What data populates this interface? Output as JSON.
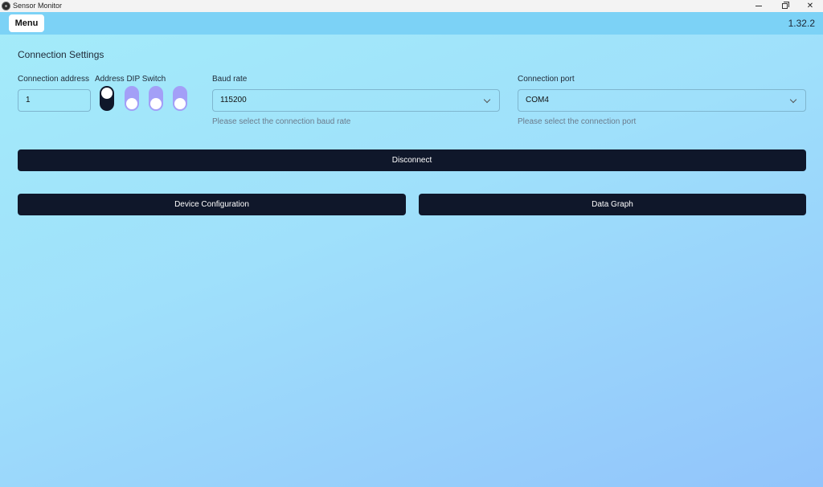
{
  "window": {
    "title": "Sensor Monitor",
    "controls": [
      "minimize",
      "restore",
      "close"
    ]
  },
  "appbar": {
    "menu_label": "Menu",
    "version": "1.32.2"
  },
  "connection_settings": {
    "title": "Connection Settings",
    "address": {
      "label": "Connection address",
      "value": "1"
    },
    "dip_switch": {
      "label": "Address DIP Switch",
      "states": [
        "on",
        "off",
        "off",
        "off"
      ]
    },
    "baud_rate": {
      "label": "Baud rate",
      "selected": "115200",
      "helper": "Please select the connection baud rate"
    },
    "port": {
      "label": "Connection port",
      "selected": "COM4",
      "helper": "Please select the connection port"
    },
    "disconnect_label": "Disconnect"
  },
  "actions": {
    "device_configuration": "Device Configuration",
    "data_graph": "Data Graph"
  },
  "colors": {
    "button_dark": "#0f172a",
    "dip_off": "#a39ff7",
    "appbar": "#7cd2f6"
  }
}
